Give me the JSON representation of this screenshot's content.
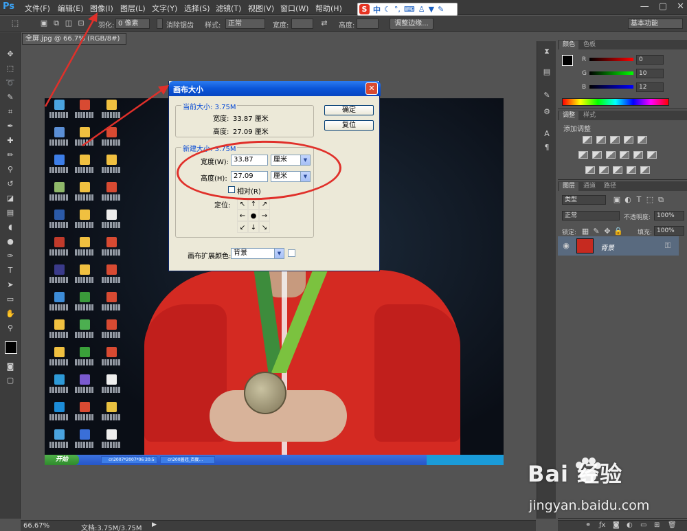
{
  "app": {
    "logo": "Ps"
  },
  "menubar": {
    "items": [
      "文件(F)",
      "编辑(E)",
      "图像(I)",
      "图层(L)",
      "文字(Y)",
      "选择(S)",
      "滤镜(T)",
      "视图(V)",
      "窗口(W)",
      "帮助(H)"
    ],
    "window_controls": [
      "—",
      "▢",
      "✕"
    ]
  },
  "ime": {
    "logo": "S",
    "mode": "中",
    "icons": [
      "moon-icon",
      "punctuation-icon",
      "keyboard-icon",
      "skin-icon",
      "shirt-icon",
      "wrench-icon"
    ]
  },
  "options": {
    "feather_label": "羽化:",
    "feather_value": "0 像素",
    "antialias_label": "消除锯齿",
    "style_label": "样式:",
    "style_value": "正常",
    "width_label": "宽度:",
    "height_label": "高度:",
    "refine_button": "调整边缘...",
    "workspace": "基本功能"
  },
  "document": {
    "tab": "全屏.jpg @ 66.7% (RGB/8#)"
  },
  "dialog": {
    "title": "画布大小",
    "close": "✕",
    "current_size_title": "当前大小: 3.75M",
    "current_width_label": "宽度:",
    "current_width_value": "33.87 厘米",
    "current_height_label": "高度:",
    "current_height_value": "27.09 厘米",
    "new_size_title": "新建大小: 3.75M",
    "width_label": "宽度(W):",
    "width_value": "33.87",
    "width_unit": "厘米",
    "height_label": "高度(H):",
    "height_value": "27.09",
    "height_unit": "厘米",
    "relative_label": "相对(R)",
    "anchor_label": "定位:",
    "extension_label": "画布扩展颜色:",
    "extension_value": "背景",
    "ok_button": "确定",
    "reset_button": "复位"
  },
  "color_panel": {
    "tabs": [
      "颜色",
      "色板"
    ],
    "r_label": "R",
    "r_value": "0",
    "g_label": "G",
    "g_value": "10",
    "b_label": "B",
    "b_value": "12"
  },
  "adjust_panel": {
    "tabs": [
      "调整",
      "样式"
    ],
    "title": "添加调整"
  },
  "layers_panel": {
    "tabs": [
      "图层",
      "通道",
      "路径"
    ],
    "kind": "类型",
    "blend": "正常",
    "opacity_label": "不透明度:",
    "opacity_value": "100%",
    "lock_label": "锁定:",
    "fill_label": "填充:",
    "fill_value": "100%",
    "layer_name": "背景"
  },
  "status": {
    "zoom": "66.67%",
    "doc": "文档:3.75M/3.75M"
  },
  "watermark": {
    "logo": "Bai  经验",
    "url": "jingyan.baidu.com"
  },
  "desktop": {
    "start": "开始",
    "tasks": [
      "cn2007*2007*06 20:5",
      "cn200届冠_百度..."
    ]
  },
  "colors": {
    "ps_bg": "#535353",
    "annotation": "#e0302a",
    "xp_title": "#0a55d8",
    "dialog_bg": "#ece9d8"
  }
}
